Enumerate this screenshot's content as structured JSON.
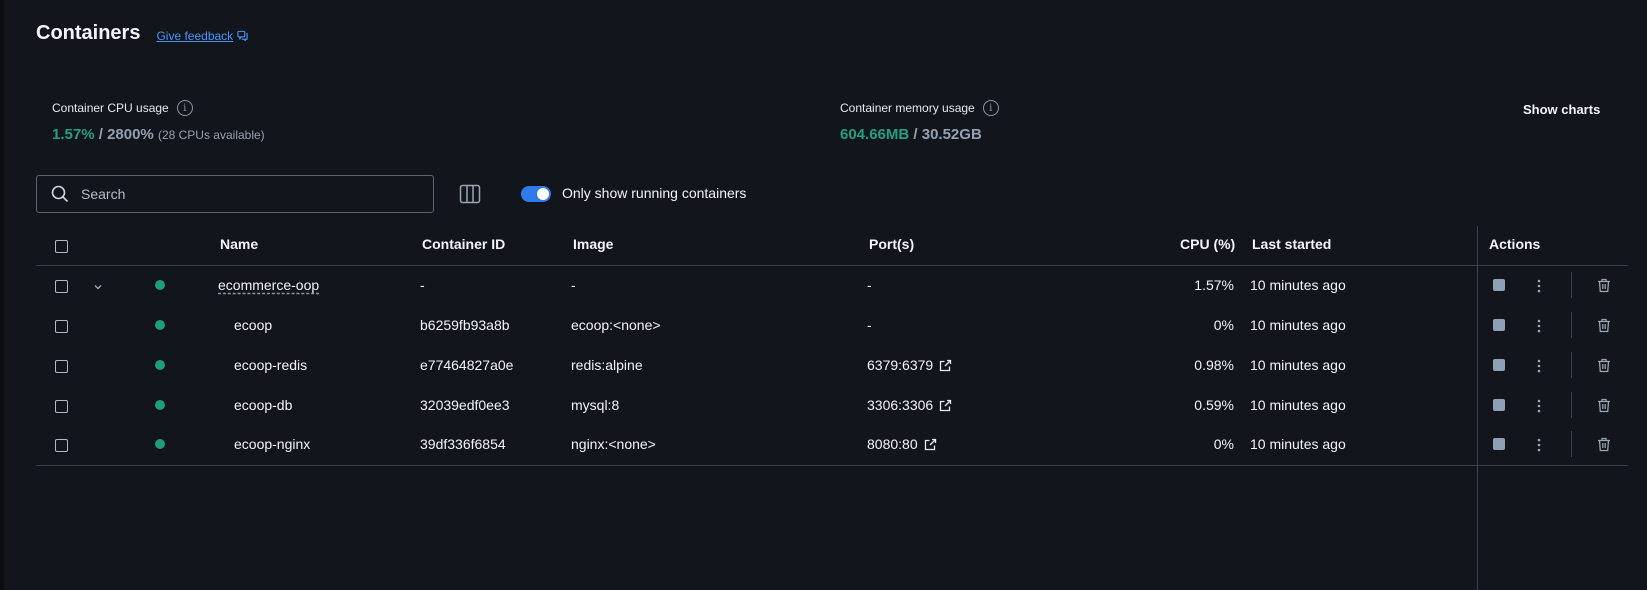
{
  "header": {
    "title": "Containers",
    "feedback_label": "Give feedback"
  },
  "stats": {
    "cpu": {
      "label": "Container CPU usage",
      "used": "1.57%",
      "separator": " / ",
      "total": "2800%",
      "note": "(28 CPUs available)"
    },
    "memory": {
      "label": "Container memory usage",
      "used": "604.66MB",
      "separator": " / ",
      "total": "30.52GB"
    },
    "show_charts_label": "Show charts"
  },
  "toolbar": {
    "search_placeholder": "Search",
    "toggle_label": "Only show running containers",
    "toggle_on": true
  },
  "table": {
    "columns": {
      "name": "Name",
      "container_id": "Container ID",
      "image": "Image",
      "ports": "Port(s)",
      "cpu": "CPU (%)",
      "last_started": "Last started",
      "actions": "Actions"
    },
    "rows": [
      {
        "name": "ecommerce-oop",
        "container_id": "-",
        "image": "-",
        "ports": "-",
        "port_link": false,
        "cpu": "1.57%",
        "last_started": "10 minutes ago",
        "group": true
      },
      {
        "name": "ecoop",
        "container_id": "b6259fb93a8b",
        "image": "ecoop:<none>",
        "ports": "-",
        "port_link": false,
        "cpu": "0%",
        "last_started": "10 minutes ago",
        "group": false
      },
      {
        "name": "ecoop-redis",
        "container_id": "e77464827a0e",
        "image": "redis:alpine",
        "ports": "6379:6379",
        "port_link": true,
        "cpu": "0.98%",
        "last_started": "10 minutes ago",
        "group": false
      },
      {
        "name": "ecoop-db",
        "container_id": "32039edf0ee3",
        "image": "mysql:8",
        "ports": "3306:3306",
        "port_link": true,
        "cpu": "0.59%",
        "last_started": "10 minutes ago",
        "group": false
      },
      {
        "name": "ecoop-nginx",
        "container_id": "39df336f6854",
        "image": "nginx:<none>",
        "ports": "8080:80",
        "port_link": true,
        "cpu": "0%",
        "last_started": "10 minutes ago",
        "group": false
      }
    ]
  },
  "colors": {
    "background": "#12161c",
    "running_green": "#1f9c79",
    "accent_blue": "#2f7bed",
    "link_blue": "#4b93f5"
  }
}
